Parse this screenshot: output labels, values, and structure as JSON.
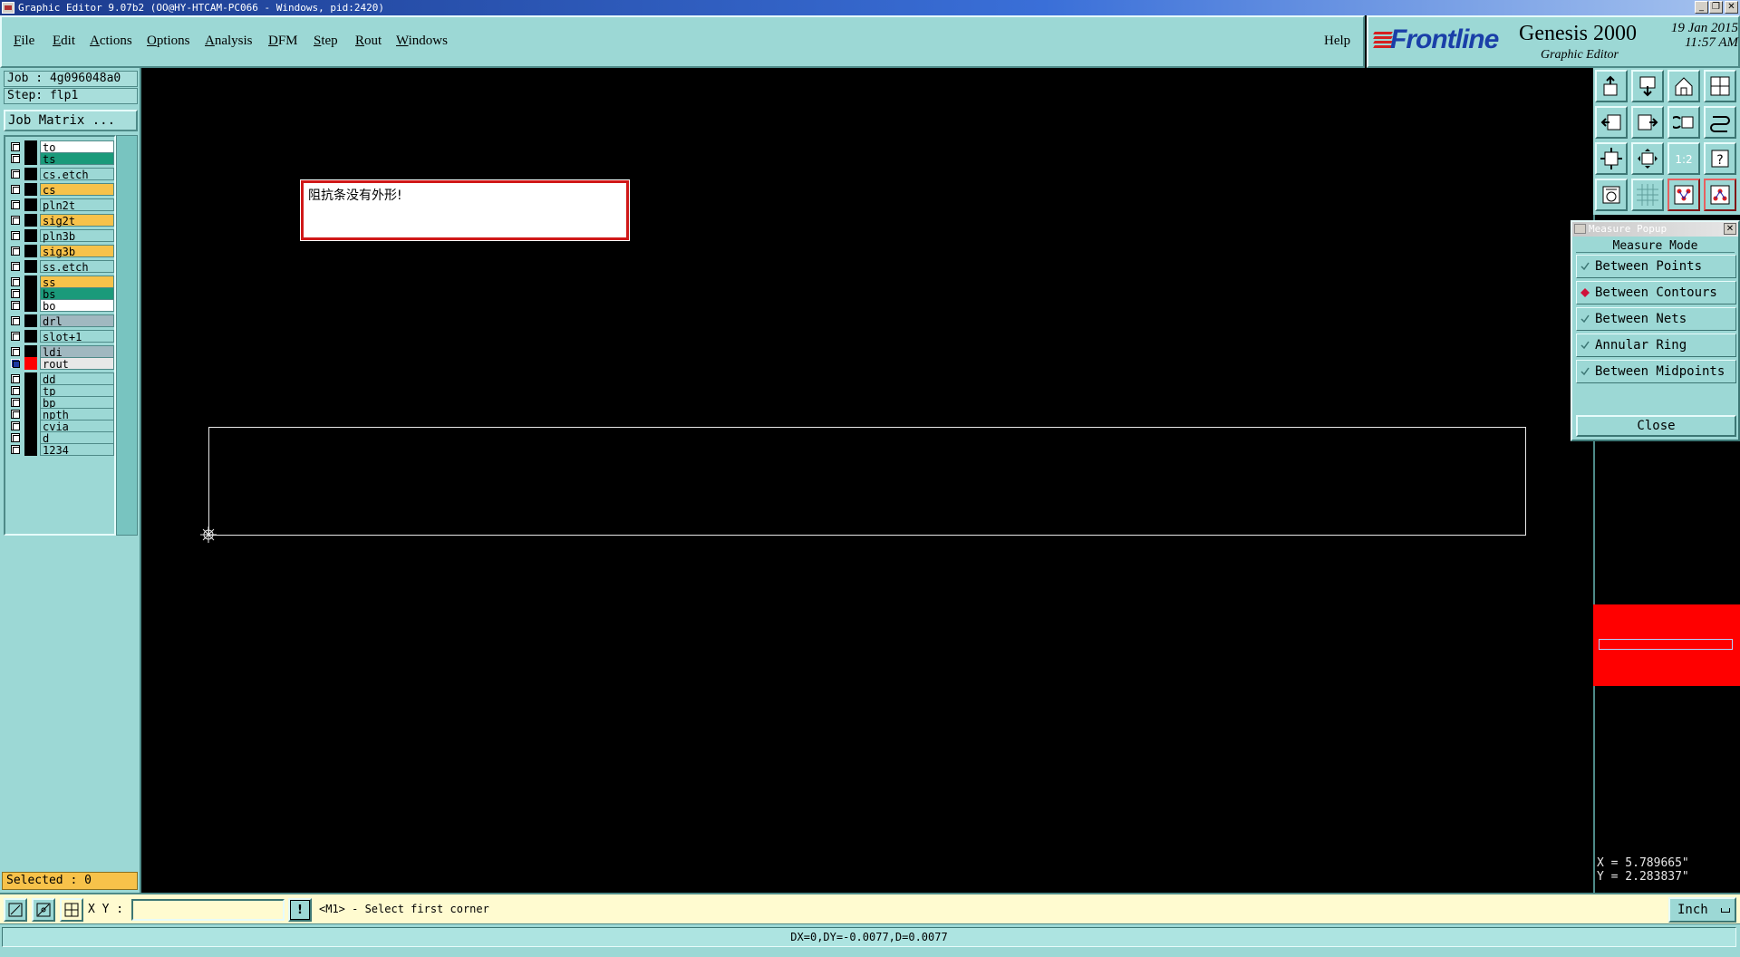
{
  "window": {
    "title": "Graphic Editor 9.07b2 (OO@HY-HTCAM-PC066 - Windows, pid:2420)",
    "controls": {
      "minimize": "_",
      "restore": "❐",
      "close": "✕"
    }
  },
  "menubar": {
    "items": [
      "File",
      "Edit",
      "Actions",
      "Options",
      "Analysis",
      "DFM",
      "Step",
      "Rout",
      "Windows"
    ],
    "help": "Help"
  },
  "branding": {
    "logo": "Frontline",
    "product": "Genesis 2000",
    "subtitle": "Graphic Editor",
    "date": "19 Jan 2015",
    "time": "11:57 AM",
    "logo_color": "#1a3fa8"
  },
  "left_panel": {
    "job": "Job : 4g096048a0",
    "step": "Step: flp1",
    "job_matrix": "Job Matrix ...",
    "layers": [
      {
        "name": "to",
        "color": "#ffffff"
      },
      {
        "name": "ts",
        "color": "#1a9a7a"
      },
      {
        "name": "cs.etch",
        "color": "#9cd8d5"
      },
      {
        "name": "cs",
        "color": "#f7c24a"
      },
      {
        "name": "pln2t",
        "color": "#9cd8d5"
      },
      {
        "name": "sig2t",
        "color": "#f7c24a"
      },
      {
        "name": "pln3b",
        "color": "#9cd8d5"
      },
      {
        "name": "sig3b",
        "color": "#f7c24a"
      },
      {
        "name": "ss.etch",
        "color": "#9cd8d5"
      },
      {
        "name": "ss",
        "color": "#f7c24a"
      },
      {
        "name": "bs",
        "color": "#1a9a7a"
      },
      {
        "name": "bo",
        "color": "#ffffff"
      },
      {
        "name": "drl",
        "color": "#a0b8c0"
      },
      {
        "name": "slot+1",
        "color": "#9cd8d5"
      },
      {
        "name": "ldi",
        "color": "#a0b8c0"
      },
      {
        "name": "rout",
        "color": "#e8e8e8",
        "active": true
      },
      {
        "name": "dd",
        "color": "#9cd8d5"
      },
      {
        "name": "tp",
        "color": "#9cd8d5"
      },
      {
        "name": "bp",
        "color": "#9cd8d5"
      },
      {
        "name": "npth",
        "color": "#9cd8d5"
      },
      {
        "name": "cvia",
        "color": "#9cd8d5"
      },
      {
        "name": "d",
        "color": "#9cd8d5"
      },
      {
        "name": "1234",
        "color": "#9cd8d5"
      }
    ],
    "selected": "Selected : 0"
  },
  "canvas": {
    "message": "阻抗条没有外形!"
  },
  "tools": {
    "icons": [
      "zoom-in-icon",
      "zoom-out-icon",
      "home-icon",
      "grid-layout-icon",
      "pan-left-icon",
      "pan-right-icon",
      "undo-view-icon",
      "redo-view-icon",
      "fit-icon",
      "zoom-fit-icon",
      "scale-icon",
      "help-query-icon",
      "snap-icon",
      "grid-icon",
      "netlist-top-icon",
      "netlist-bottom-icon"
    ],
    "scale_label": "1:2",
    "help_label": "?"
  },
  "measure_popup": {
    "title": "Measure Popup",
    "heading": "Measure Mode",
    "modes": [
      {
        "label": "Between Points",
        "selected": false
      },
      {
        "label": "Between Contours",
        "selected": true
      },
      {
        "label": "Between Nets",
        "selected": false
      },
      {
        "label": "Annular Ring",
        "selected": false
      },
      {
        "label": "Between Midpoints",
        "selected": false
      }
    ],
    "close": "Close",
    "close_x": "✕"
  },
  "coords": {
    "x": "X = 5.789665\"",
    "y": "Y = 2.283837\""
  },
  "command_bar": {
    "xy_label": "X Y :",
    "xy_value": "",
    "prompt": "<M1> - Select first corner",
    "unit": "Inch",
    "alert_label": "!"
  },
  "status": {
    "text": "DX=0,DY=-0.0077,D=0.0077"
  }
}
